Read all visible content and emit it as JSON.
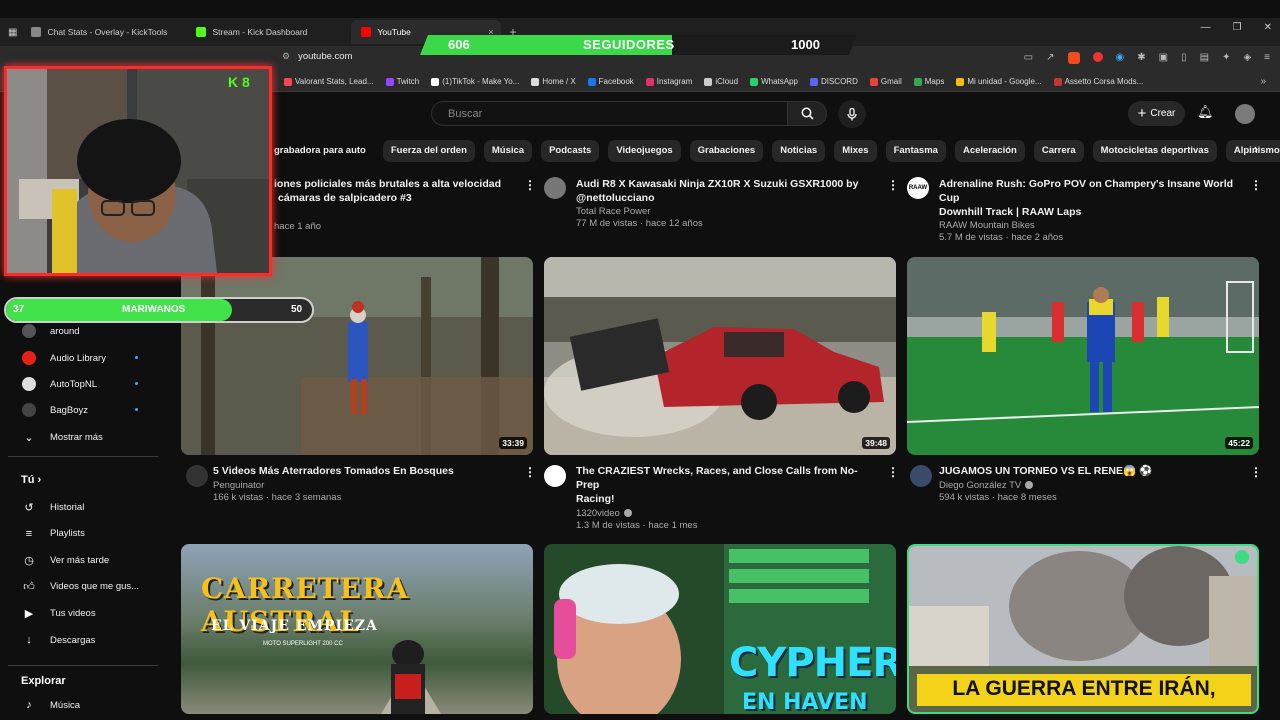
{
  "browser": {
    "tabs": [
      {
        "label": "Chat Stats - Overlay - KickTools",
        "color": "#8a8a8a"
      },
      {
        "label": "Stream - Kick Dashboard",
        "color": "#53fc18"
      },
      {
        "label": "YouTube",
        "color": "#ff0000"
      }
    ],
    "close_glyph": "×",
    "new_tab": "+",
    "url": "youtube.com",
    "bookmarks": [
      {
        "label": "Valorant Stats, Lead...",
        "color": "#ff4655"
      },
      {
        "label": "Twitch",
        "color": "#9146ff"
      },
      {
        "label": "(1)TikTok - Make Yo...",
        "color": "#ffffff"
      },
      {
        "label": "Home / X",
        "color": "#dddddd"
      },
      {
        "label": "Facebook",
        "color": "#1877f2"
      },
      {
        "label": "Instagram",
        "color": "#e1306c"
      },
      {
        "label": "iCloud",
        "color": "#cccccc"
      },
      {
        "label": "WhatsApp",
        "color": "#25d366"
      },
      {
        "label": "DISCORD",
        "color": "#5865f2"
      },
      {
        "label": "Gmail",
        "color": "#ea4335"
      },
      {
        "label": "Maps",
        "color": "#34a853"
      },
      {
        "label": "Mi unidad - Google...",
        "color": "#fbbc04"
      },
      {
        "label": "Assetto Corsa Mods...",
        "color": "#c0392b"
      }
    ]
  },
  "overlay": {
    "followers_current": "606",
    "followers_label": "SEGUIDORES",
    "followers_goal": "1000",
    "followers_progress": 0.606,
    "bar_label": "MARIWANOS",
    "bar_current": "37",
    "bar_goal": "50",
    "bar_progress": 0.74,
    "kick_badge": "K 8"
  },
  "youtube": {
    "search_placeholder": "Buscar",
    "create_label": "Crear",
    "chips": [
      "grabadora para auto",
      "Fuerza del orden",
      "Música",
      "Podcasts",
      "Videojuegos",
      "Grabaciones",
      "Noticias",
      "Mixes",
      "Fantasma",
      "Aceleración",
      "Carrera",
      "Motocicletas deportivas",
      "Alpinismo",
      "En"
    ]
  },
  "sidebar": {
    "channels": [
      {
        "label": "around",
        "color": "#555555"
      },
      {
        "label": "Audio Library",
        "color": "#e62117"
      },
      {
        "label": "AutoTopNL",
        "color": "#dddddd"
      },
      {
        "label": "BagBoyz",
        "color": "#444444"
      }
    ],
    "show_more": "Mostrar más",
    "you_header": "Tú",
    "you_items": [
      "Historial",
      "Playlists",
      "Ver más tarde",
      "Videos que me gus...",
      "Tus videos",
      "Descargas"
    ],
    "explore_header": "Explorar",
    "explore_items": [
      "Música"
    ]
  },
  "videos_row1": [
    {
      "title_line1": "iones policiales más brutales a alta velocidad",
      "title_line2": "cámaras de salpicadero #3",
      "channel": "",
      "stats": "hace 1 año"
    },
    {
      "title_line1": "Audi R8 X Kawasaki Ninja ZX10R X Suzuki GSXR1000 by",
      "title_line2": "@nettolucciano",
      "channel": "Total Race Power",
      "stats": "77 M de vistas · hace 12 años"
    },
    {
      "title_line1": "Adrenaline Rush: GoPro POV on Champery's Insane World Cup",
      "title_line2": "Downhill Track | RAAW Laps",
      "channel": "RAAW Mountain Bikes",
      "stats": "5.7 M de vistas · hace 2 años"
    }
  ],
  "videos_row2": [
    {
      "title_line1": "5 Videos Más Aterradores Tomados En Bosques",
      "title_line2": "",
      "channel": "Penguinator",
      "stats": "166 k vistas · hace 3 semanas",
      "duration": "33:39"
    },
    {
      "title_line1": "The CRAZIEST Wrecks, Races, and Close Calls from No-Prep",
      "title_line2": "Racing!",
      "channel": "1320video",
      "stats": "1.3 M de vistas · hace 1 mes",
      "duration": "39:48"
    },
    {
      "title_line1": "JUGAMOS UN TORNEO VS EL RENE😱 ⚽",
      "title_line2": "",
      "channel": "Diego González TV",
      "stats": "594 k vistas · hace 8 meses",
      "duration": "45:22"
    }
  ],
  "thumb_texts": {
    "austral_title": "CARRETERA AUSTRAL",
    "austral_sub": "EL VIAJE EMPIEZA",
    "austral_small": "MOTO SUPERLIGHT 200 CC",
    "cypher": "CYPHER",
    "cypher2": "EN HAVEN",
    "guerra": "LA GUERRA ENTRE IRÁN,"
  }
}
